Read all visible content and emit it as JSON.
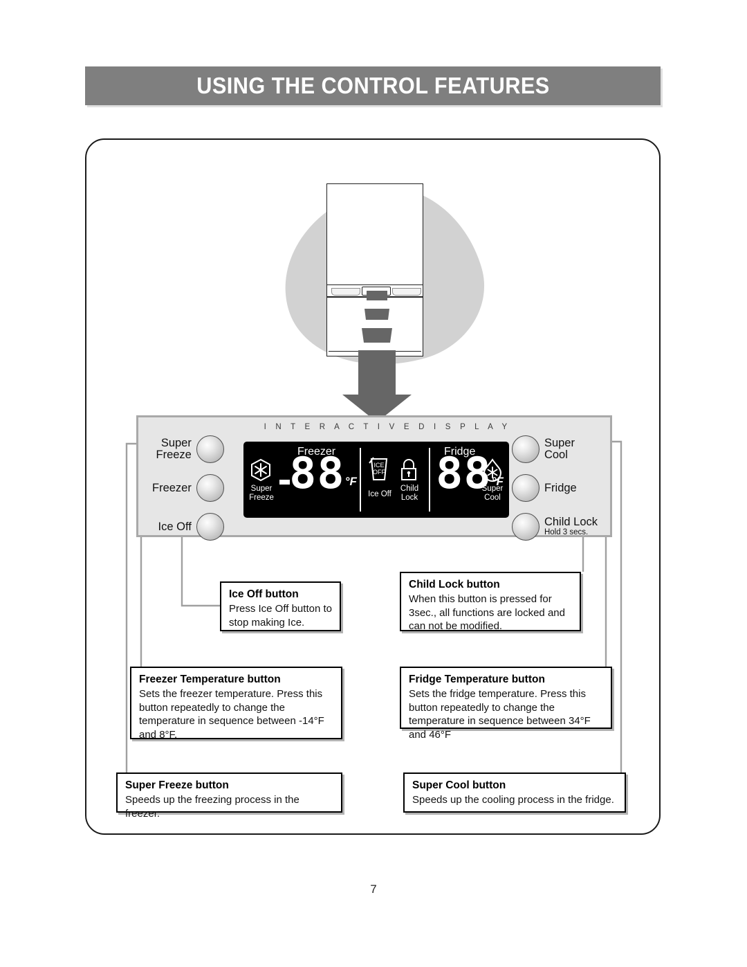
{
  "page": {
    "title": "USING THE CONTROL FEATURES",
    "number": "7"
  },
  "control_panel": {
    "display_label": "I N T E R A C T I V E    D I S P L A Y",
    "left_buttons": [
      {
        "label_line1": "Super",
        "label_line2": "Freeze",
        "name": "super-freeze"
      },
      {
        "label_line1": "Freezer",
        "label_line2": "",
        "name": "freezer"
      },
      {
        "label_line1": "Ice Off",
        "label_line2": "",
        "name": "ice-off"
      }
    ],
    "right_buttons": [
      {
        "label_line1": "Super",
        "label_line2": "Cool",
        "sub": "",
        "name": "super-cool"
      },
      {
        "label_line1": "Fridge",
        "label_line2": "",
        "sub": "",
        "name": "fridge"
      },
      {
        "label_line1": "Child Lock",
        "label_line2": "",
        "sub": "Hold  3 secs.",
        "name": "child-lock"
      }
    ]
  },
  "lcd": {
    "freezer_title": "Freezer",
    "fridge_title": "Fridge",
    "freezer_value": "88",
    "fridge_value": "88",
    "freezer_unit": "°F",
    "fridge_unit": "°F",
    "freezer_sign": "-",
    "super_freeze_caption_1": "Super",
    "super_freeze_caption_2": "Freeze",
    "super_cool_caption_1": "Super",
    "super_cool_caption_2": "Cool",
    "ice_off_caption": "Ice Off",
    "ice_glyph_line1": "ICE",
    "ice_glyph_line2": "OFF",
    "child_lock_caption_1": "Child",
    "child_lock_caption_2": "Lock"
  },
  "callouts": {
    "ice_off": {
      "heading": "Ice Off button",
      "body": "Press Ice Off button to stop making Ice."
    },
    "child_lock": {
      "heading": "Child Lock button",
      "body": "When this button is pressed for 3sec., all functions are locked and can not be modified."
    },
    "freezer_temp": {
      "heading": "Freezer Temperature button",
      "body": "Sets the freezer temperature.\nPress this button repeatedly to change the temperature in sequence between -14°F and 8°F."
    },
    "fridge_temp": {
      "heading": "Fridge Temperature button",
      "body": "Sets the fridge temperature.\nPress this button repeatedly to change the temperature in sequence between 34°F and 46°F"
    },
    "super_freeze": {
      "heading": "Super Freeze button",
      "body": "Speeds up the freezing process in the freezer."
    },
    "super_cool": {
      "heading": "Super Cool button",
      "body": "Speeds up the cooling process in the fridge."
    }
  },
  "colors": {
    "banner": "#7f7f7f",
    "panel_bg": "#e6e6e6",
    "blob": "#d2d2d2",
    "arrow": "#666666",
    "lcd_bg": "#000000"
  }
}
